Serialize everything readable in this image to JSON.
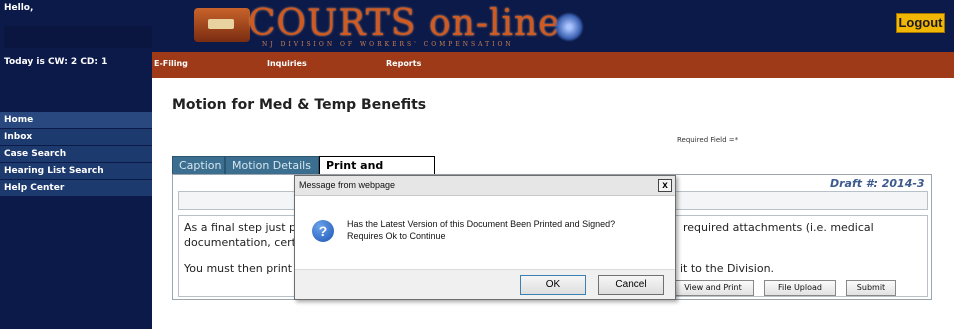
{
  "sidebar": {
    "hello": "Hello,",
    "today": "Today is CW: 2 CD: 1",
    "items": [
      {
        "label": "Home"
      },
      {
        "label": "Inbox"
      },
      {
        "label": "Case Search"
      },
      {
        "label": "Hearing List Search"
      },
      {
        "label": "Help Center"
      }
    ]
  },
  "header": {
    "logo_title": "COURTS on-line",
    "logo_subtitle": "NJ DIVISION OF WORKERS' COMPENSATION",
    "logout_label": "Logout"
  },
  "menu": {
    "items": [
      {
        "label": "E-Filing"
      },
      {
        "label": "Inquiries"
      },
      {
        "label": "Reports"
      }
    ]
  },
  "main": {
    "page_title": "Motion for Med & Temp Benefits",
    "required_note": "Required Field =*",
    "tabs": [
      {
        "label": "Caption",
        "active": false
      },
      {
        "label": "Motion Details",
        "active": false
      },
      {
        "label": "Print and Submit",
        "active": true
      }
    ],
    "draft_label": "Draft #: 2014-3",
    "text": {
      "line1_start": "As a final step just p",
      "line1_end": "required attachments (i.e. medical",
      "line2_start": "documentation, certi",
      "line3_start": "You must then print",
      "line3_end": "it to the Division."
    },
    "buttons": {
      "view_print": "View and Print",
      "file_upload": "File Upload",
      "submit": "Submit"
    }
  },
  "dialog": {
    "title": "Message from webpage",
    "close_glyph": "x",
    "icon_glyph": "?",
    "message_line1": "Has the Latest Version of this Document Been Printed and Signed?",
    "message_line2": "Requires Ok to Continue",
    "ok_label": "OK",
    "cancel_label": "Cancel"
  }
}
